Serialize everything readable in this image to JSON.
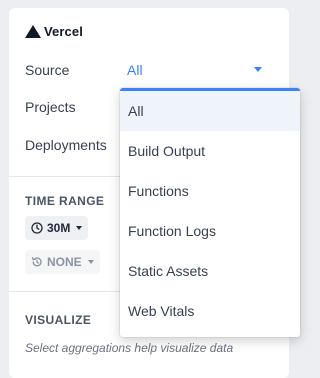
{
  "brand": {
    "name": "Vercel"
  },
  "filters": {
    "source_label": "Source",
    "source_value": "All",
    "projects_label": "Projects",
    "deployments_label": "Deployments"
  },
  "time_range": {
    "title": "TIME RANGE",
    "range_value": "30M",
    "compare_value": "NONE"
  },
  "visualize": {
    "title": "VISUALIZE",
    "hint": "Select aggregations help visualize data"
  },
  "source_dropdown": {
    "selected_index": 0,
    "options": [
      "All",
      "Build Output",
      "Functions",
      "Function Logs",
      "Static Assets",
      "Web Vitals"
    ]
  },
  "colors": {
    "accent": "#3b82f6",
    "text": "#374151"
  },
  "icons": {
    "range": "clock-icon",
    "compare": "history-icon",
    "caret": "caret-down-icon",
    "logo": "vercel-triangle-icon"
  }
}
